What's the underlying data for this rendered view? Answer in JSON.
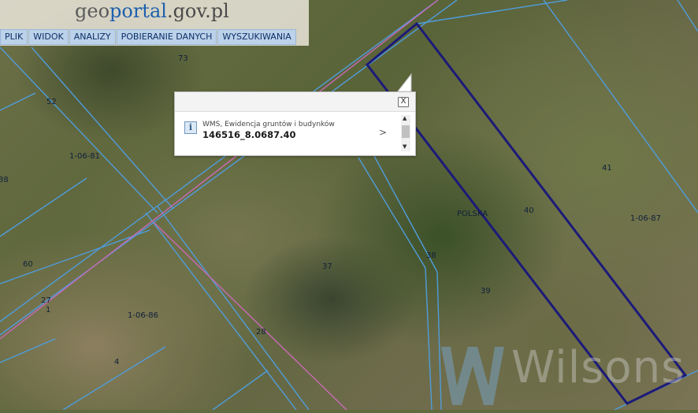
{
  "header": {
    "logo": {
      "part1": "geo",
      "part2": "portal",
      "part3": ".gov.pl"
    },
    "menu": [
      "PLIK",
      "WIDOK",
      "ANALIZY",
      "POBIERANIE DANYCH",
      "WYSZUKIWANIA"
    ]
  },
  "popup": {
    "close_label": "X",
    "info_icon_label": "i",
    "layer_name": "WMS, Ewidencja gruntów i budynków",
    "value": "146516_8.0687.40",
    "next_label": ">",
    "scroll_up": "▲",
    "scroll_down": "▼"
  },
  "map": {
    "labels": {
      "p73": "73",
      "p52": "52",
      "p106_81": "1-06-81",
      "p38_left": "38",
      "p60": "60",
      "p27": "27",
      "p1": "1",
      "p106_86": "1-06-86",
      "p4": "4",
      "p28": "28",
      "p37": "37",
      "p38": "38",
      "p39": "39",
      "p40": "40",
      "polska": "POLSKA",
      "p41": "41",
      "p106_87": "1-06-87"
    },
    "colors": {
      "parcel_line": "#4f9ddc",
      "selected_parcel": "#1c1a78",
      "boundary_line": "#c86ab4"
    }
  },
  "watermark": {
    "text": "Wilsons"
  }
}
